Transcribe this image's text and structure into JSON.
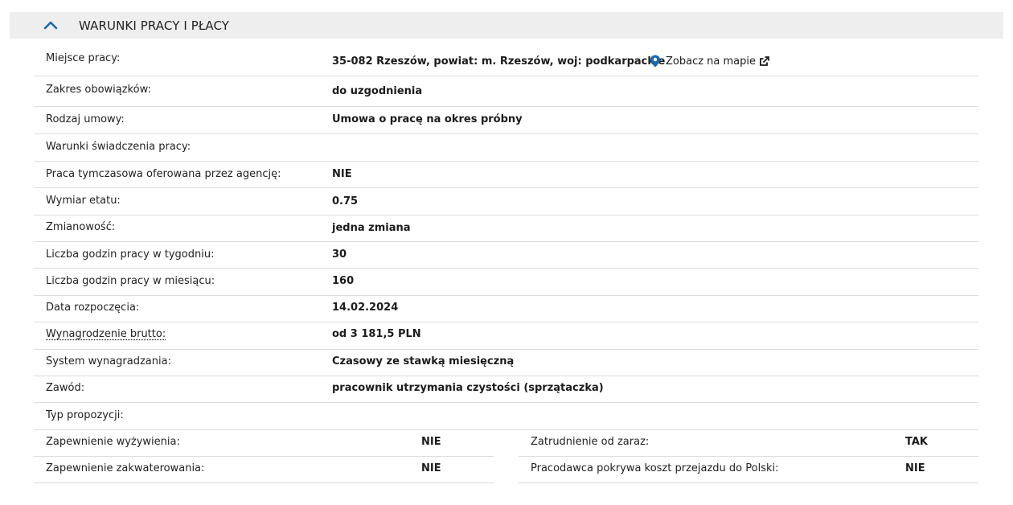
{
  "section": {
    "title": "WARUNKI PRACY I PŁACY"
  },
  "rows": [
    {
      "label": "Miejsce pracy:",
      "value": "35-082 Rzeszów, powiat: m. Rzeszów, woj: podkarpackie"
    },
    {
      "label": "Zakres obowiązków:",
      "value": "do uzgodnienia"
    },
    {
      "label": "Rodzaj umowy:",
      "value": "Umowa o pracę na okres próbny"
    },
    {
      "label": "Warunki świadczenia pracy:",
      "value": ""
    },
    {
      "label": "Praca tymczasowa oferowana przez agencję:",
      "value": "NIE"
    },
    {
      "label": "Wymiar etatu:",
      "value": "0.75"
    },
    {
      "label": "Zmianowość:",
      "value": "jedna zmiana"
    },
    {
      "label": "Liczba godzin pracy w tygodniu:",
      "value": "30"
    },
    {
      "label": "Liczba godzin pracy w miesiącu:",
      "value": "160"
    },
    {
      "label": "Data rozpoczęcia:",
      "value": "14.02.2024"
    },
    {
      "label": "Wynagrodzenie brutto:",
      "value": "od 3 181,5 PLN"
    },
    {
      "label": "System wynagradzania:",
      "value": "Czasowy ze stawką miesięczną"
    },
    {
      "label": "Zawód:",
      "value": "pracownik utrzymania czystości (sprzątaczka)"
    },
    {
      "label": "Typ propozycji:",
      "value": ""
    }
  ],
  "map_link": {
    "label": "Zobacz na mapie"
  },
  "extras_left": [
    {
      "label": "Zapewnienie wyżywienia:",
      "value": "NIE"
    },
    {
      "label": "Zapewnienie zakwaterowania:",
      "value": "NIE"
    }
  ],
  "extras_right": [
    {
      "label": "Zatrudnienie od zaraz:",
      "value": "TAK"
    },
    {
      "label": "Pracodawca pokrywa koszt przejazdu do Polski:",
      "value": "NIE"
    }
  ],
  "colors": {
    "accent": "#1a6aa8",
    "header_bg": "#eeeeee",
    "divider": "#dcdcdc"
  },
  "icons": {
    "collapse": "chevron-up-icon",
    "map": "map-pin-icon",
    "external": "external-link-icon"
  }
}
